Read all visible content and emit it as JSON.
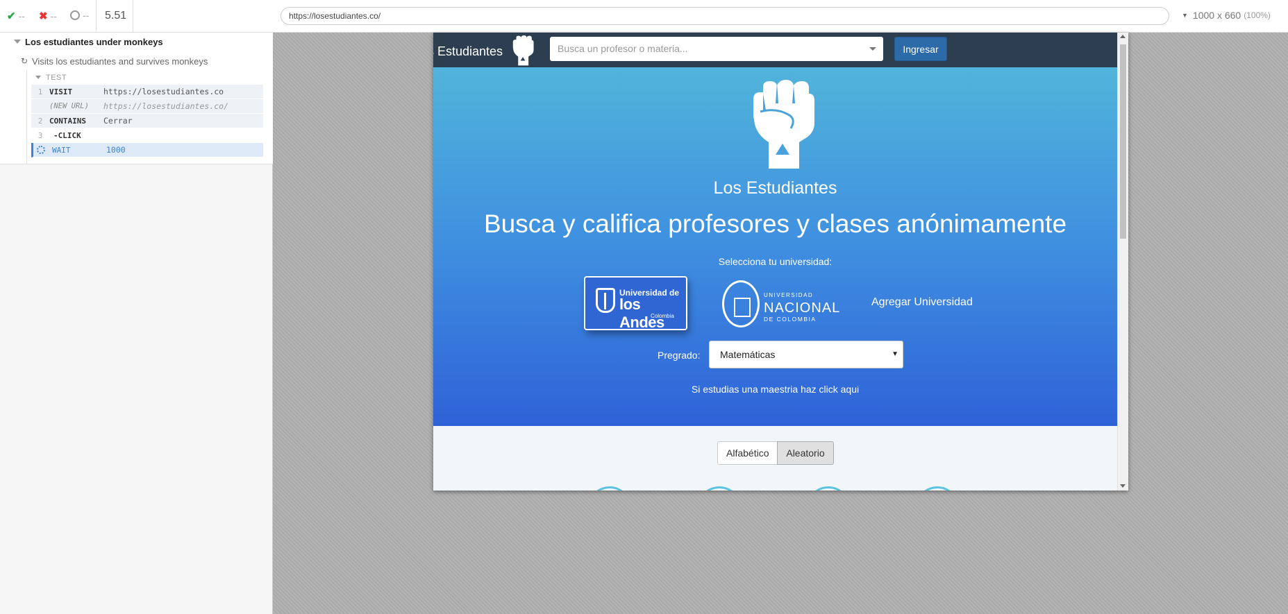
{
  "reporter": {
    "passed": "--",
    "failed": "--",
    "pending": "--",
    "duration": "5.51",
    "url": "https://losestudiantes.co/",
    "viewport": "1000 x 660",
    "viewport_scale": "(100%)",
    "icons": {
      "passed": "check-icon",
      "failed": "x-icon",
      "pending": "circle-icon"
    },
    "colors": {
      "passed": "#28a745",
      "failed": "#ee3333",
      "active_command": "#3b84d6"
    }
  },
  "runner": {
    "suite_title": "Los estudiantes under monkeys",
    "test_title": "Visits los estudiantes and survives monkeys",
    "section_label": "TEST",
    "commands": [
      {
        "num": "1",
        "name": "VISIT",
        "message": "https://losestudiantes.co"
      },
      {
        "num": "",
        "name": "(NEW URL)",
        "message": "https://losestudiantes.co/"
      },
      {
        "num": "2",
        "name": "CONTAINS",
        "message": "Cerrar"
      },
      {
        "num": "3",
        "name": "-CLICK",
        "message": ""
      },
      {
        "num": "",
        "name": "WAIT",
        "message": "1000"
      }
    ]
  },
  "app": {
    "navbar": {
      "brand": "s Estudiantes",
      "search_placeholder": "Busca un profesor o materia...",
      "login_label": "Ingresar",
      "bg_color": "#2c3e50"
    },
    "hero": {
      "brand": "Los Estudiantes",
      "tagline": "Busca y califica profesores y clases anónimamente",
      "select_university": "Selecciona tu universidad:",
      "universities": {
        "andes": {
          "line1": "Universidad de",
          "line2": "los Andes",
          "line3": "Colombia"
        },
        "nacional": {
          "line1": "UNIVERSIDAD",
          "line2": "NACIONAL",
          "line3": "DE COLOMBIA"
        }
      },
      "add_university": "Agregar Universidad",
      "program_label": "Pregrado:",
      "program_value": "Matemáticas",
      "masters_link": "Si estudias una maestria haz click aqui"
    },
    "sort": {
      "alphabetical": "Alfabético",
      "random": "Aleatorio"
    }
  }
}
